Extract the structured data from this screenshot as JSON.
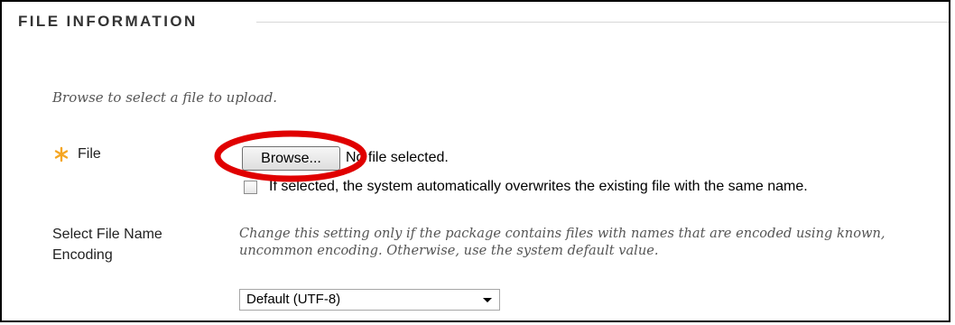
{
  "section": {
    "title": "FILE INFORMATION"
  },
  "instructions": "Browse to select a file to upload.",
  "file_field": {
    "label": "File",
    "required_icon": "required-asterisk-icon",
    "browse_button_label": "Browse...",
    "no_file_text": "No file selected.",
    "overwrite_checkbox_text": "If selected, the system automatically overwrites the existing file with the same name.",
    "overwrite_checked": false
  },
  "encoding": {
    "label": "Select File Name Encoding",
    "help_text": "Change this setting only if the package contains files with names that are encoded using known, uncommon encoding. Otherwise, use the system default value.",
    "selected_value": "Default (UTF-8)"
  },
  "colors": {
    "required_icon": "#f5a623",
    "annotation_circle": "#e00000",
    "frame_border": "#000000"
  }
}
